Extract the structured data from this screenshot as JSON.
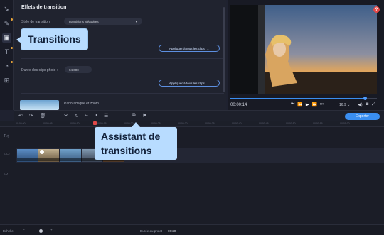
{
  "panel": {
    "title": "Effets de transition",
    "style_label": "Style de transition",
    "style_value": "Transitions aléatoires",
    "apply_all_label": "Appliquer à tous les clips",
    "photo_duration_label": "Durée des clips photo :",
    "photo_duration_value": "04.000",
    "apply_all_label_2": "Appliquer à tous les clips",
    "pan_zoom_label": "Panoramique et zoom"
  },
  "tooltips": {
    "transitions": "Transitions",
    "assistant": "Assistant de transitions"
  },
  "player": {
    "timecode": "00:00:14",
    "aspect_ratio": "16:9",
    "help": "?",
    "progress": 0.92
  },
  "toolbar": {
    "export_label": "Exporter"
  },
  "ruler": {
    "ticks": [
      "00:00:00",
      "00:00:05",
      "00:00:10",
      "00:00:15",
      "00:00:20",
      "00:00:25",
      "00:00:30",
      "00:00:35",
      "00:00:40",
      "00:00:45",
      "00:00:50",
      "00:00:55",
      "00:01:00"
    ]
  },
  "status": {
    "scale_label": "Échelle",
    "project_duration_label": "Durée du projet",
    "project_duration_value": "00:20"
  },
  "colors": {
    "accent": "#3a8ef0",
    "tooltip_bg": "#b8dcff",
    "playhead": "#e04848"
  }
}
